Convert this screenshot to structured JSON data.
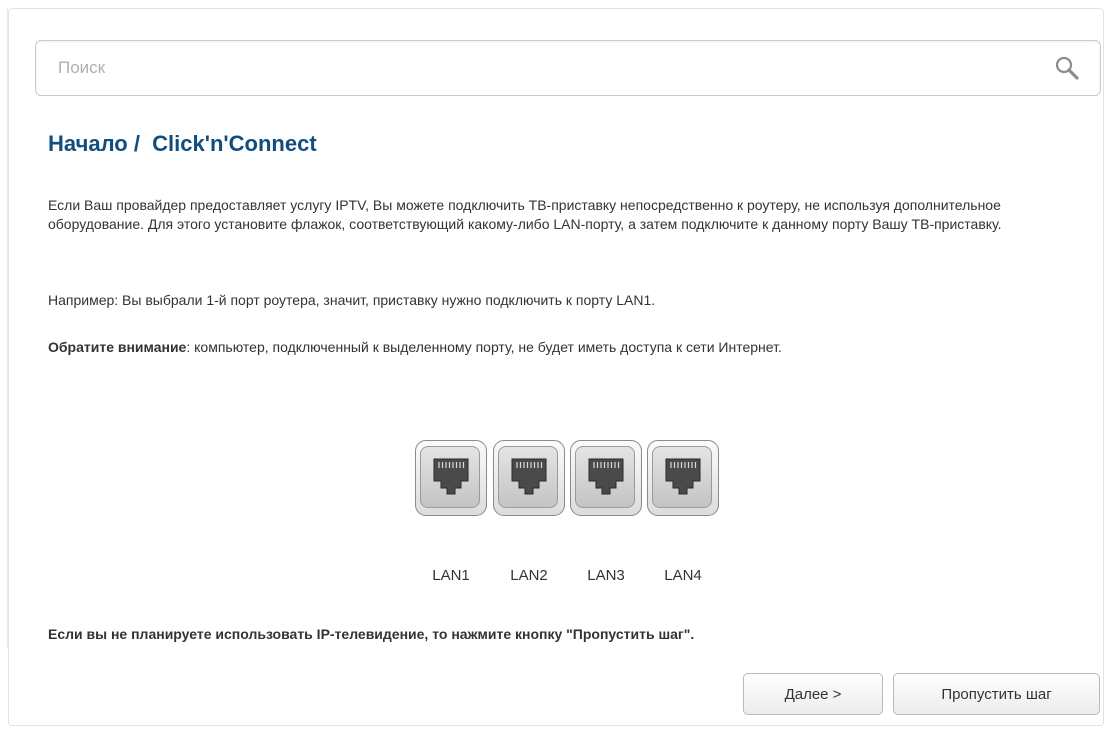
{
  "search": {
    "placeholder": "Поиск",
    "value": ""
  },
  "page": {
    "title": "Начало /  Click'n'Connect",
    "paragraph_1": "Если Ваш провайдер предоставляет услугу IPTV, Вы можете подключить ТВ-приставку непосредственно к роутеру, не используя дополнительное оборудование. Для этого установите флажок, соответствующий какому-либо LAN-порту, а затем подключите к данному порту Вашу ТВ-приставку.",
    "paragraph_2": "Например: Вы выбрали 1-й порт роутера, значит, приставку нужно подключить к порту LAN1.",
    "note_label": "Обратите внимание",
    "note_text": ": компьютер, подключенный к выделенному порту, не будет иметь доступа к сети Интернет.",
    "skip_note": "Если вы не планируете использовать IP-телевидение, то нажмите кнопку \"Пропустить шаг\"."
  },
  "ports": [
    {
      "label": "LAN1",
      "icon": "ethernet-port-icon"
    },
    {
      "label": "LAN2",
      "icon": "ethernet-port-icon"
    },
    {
      "label": "LAN3",
      "icon": "ethernet-port-icon"
    },
    {
      "label": "LAN4",
      "icon": "ethernet-port-icon"
    }
  ],
  "buttons": {
    "next_label": "Далее >",
    "skip_label": "Пропустить шаг"
  },
  "colors": {
    "title": "#124d80",
    "text": "#333333",
    "placeholder": "#b0b0b0"
  }
}
